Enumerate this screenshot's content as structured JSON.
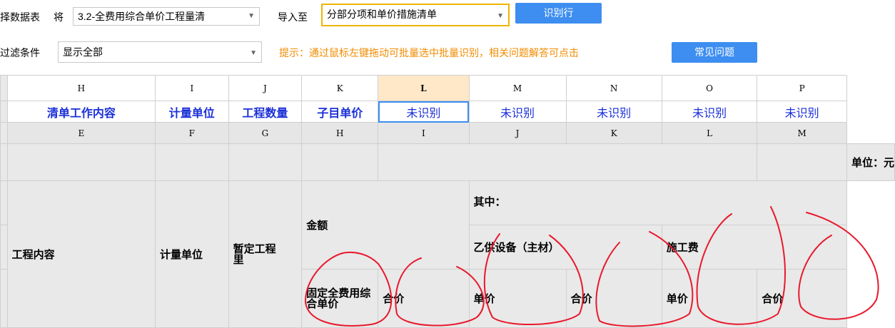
{
  "toolbar": {
    "select_sheet_label": "择数据表",
    "jiang_label": "将",
    "sheet_value": "3.2-全费用综合单价工程量清",
    "import_to_label": "导入至",
    "target_value": "分部分项和单价措施清单",
    "recognize_button": "识别行",
    "filter_label": "过滤条件",
    "filter_value": "显示全部",
    "hint_text": "提示：通过鼠标左键拖动可批量选中批量识别，相关问题解答可点击",
    "faq_button": "常见问题"
  },
  "grid": {
    "col_headers": [
      "H",
      "I",
      "J",
      "K",
      "L",
      "M",
      "N",
      "O",
      "P"
    ],
    "mapping": [
      "清单工作内容",
      "计量单位",
      "工程数量",
      "子目单价",
      "未识别",
      "未识别",
      "未识别",
      "未识别",
      "未识别"
    ],
    "source_letters": [
      "E",
      "F",
      "G",
      "H",
      "I",
      "J",
      "K",
      "L",
      "M"
    ],
    "unit_note": "单位：元",
    "cells": {
      "work_content": "工程内容",
      "unit": "计量单位",
      "provisional_qty": "暂定工程里",
      "amount": "金额",
      "of_which": "其中：",
      "supplied_equipment": "乙供设备（主材）",
      "construction_fee": "施工费",
      "fixed_price": "固定全费用综合单价",
      "total_price_1": "合价",
      "unit_price_1": "单价",
      "total_price_2": "合价",
      "unit_price_2": "单价",
      "total_price_3": "合价"
    }
  },
  "colors": {
    "accent": "#3d8ef0",
    "hint": "#f08c00",
    "mapped": "#1a2fd8",
    "annotation": "#e8192c"
  }
}
